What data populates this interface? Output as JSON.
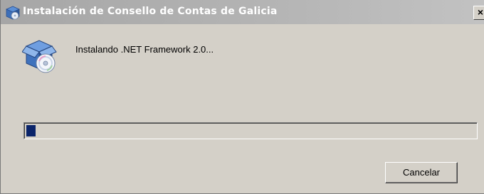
{
  "window": {
    "title": "Instalación de Consello de Contas de Galicia",
    "close_glyph": "×",
    "title_icon": "installer-box-icon"
  },
  "main": {
    "icon": "installer-disc-icon",
    "status_text": "Instalando .NET Framework 2.0..."
  },
  "progress": {
    "percent": 2,
    "color": "#0a246a"
  },
  "buttons": {
    "cancel_label": "Cancelar"
  }
}
